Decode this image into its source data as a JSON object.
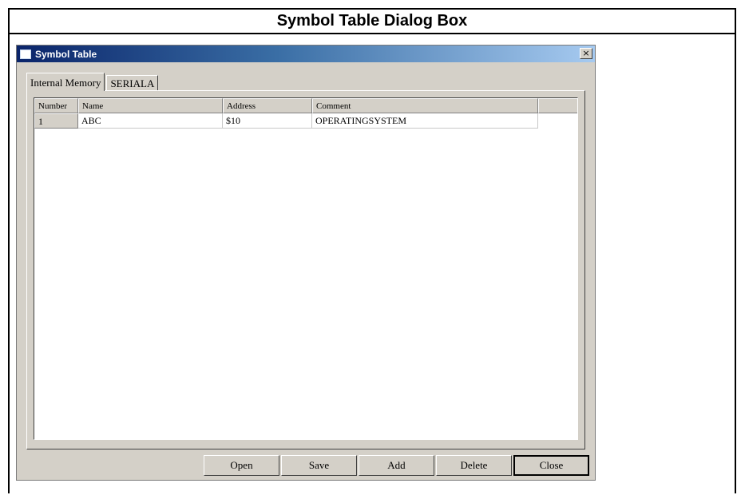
{
  "document": {
    "header_title": "Symbol Table Dialog Box"
  },
  "window": {
    "title": "Symbol Table",
    "close_glyph": "×"
  },
  "tabs": [
    {
      "label": "Internal Memory",
      "active": true
    },
    {
      "label": "SERIALA",
      "active": false
    }
  ],
  "table": {
    "columns": [
      "Number",
      "Name",
      "Address",
      "Comment"
    ],
    "rows": [
      {
        "number": "1",
        "name": "ABC",
        "address": "$10",
        "comment": "OPERATINGSYSTEM"
      }
    ]
  },
  "buttons": {
    "open": "Open",
    "save": "Save",
    "add": "Add",
    "delete": "Delete",
    "close": "Close"
  },
  "icons": {
    "window_icon": "window-icon",
    "close_icon": "close-icon"
  },
  "colors": {
    "titlebar_start": "#0a246a",
    "titlebar_end": "#a6caf0",
    "dialog_face": "#d4d0c8"
  }
}
